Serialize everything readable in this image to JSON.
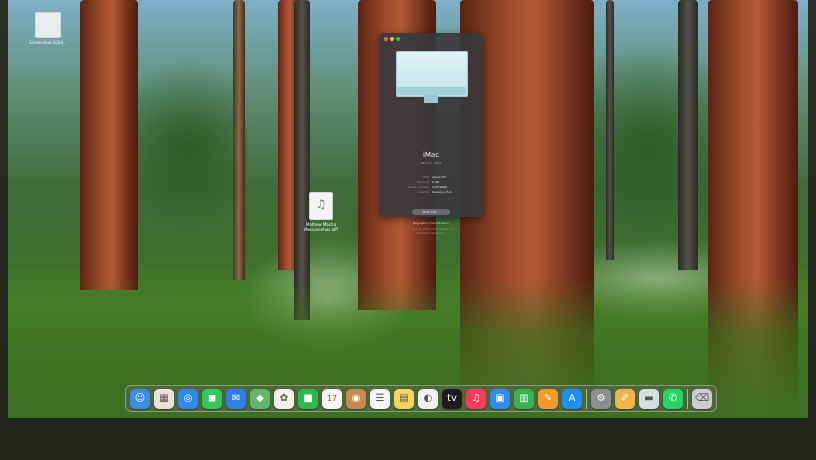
{
  "desktop": {
    "icons": [
      {
        "label": "Screenshot 2024…"
      },
      {
        "label": "Mathew Macha Mascarenhas.aiff"
      }
    ]
  },
  "about_window": {
    "traffic_colors": [
      "#ff5f57",
      "#febc2e",
      "#28c840"
    ],
    "title": "iMac",
    "model": "24-inch, 2021",
    "specs": [
      {
        "key": "Chip",
        "value": "Apple M1"
      },
      {
        "key": "Memory",
        "value": "8 GB"
      },
      {
        "key": "Serial number",
        "value": "C02TJ0KJ0"
      },
      {
        "key": "macOS",
        "value": "Sequoia 15.0"
      }
    ],
    "more_info_label": "More Info…",
    "regulatory_label": "Regulatory Certification",
    "legal_lines": [
      "™ and © 1983-2024 Apple Inc.",
      "All Rights Reserved."
    ]
  },
  "dock": {
    "apps": [
      {
        "name": "finder-icon",
        "color": "#3b8ee8",
        "glyph": "☺"
      },
      {
        "name": "launchpad-icon",
        "color": "#e9e3d9",
        "glyph": "▦"
      },
      {
        "name": "safari-icon",
        "color": "#2d8ceb",
        "glyph": "◎"
      },
      {
        "name": "messages-icon",
        "color": "#34c759",
        "glyph": "◼"
      },
      {
        "name": "mail-icon",
        "color": "#2f7fe6",
        "glyph": "✉"
      },
      {
        "name": "maps-icon",
        "color": "#5fb86a",
        "glyph": "◆"
      },
      {
        "name": "photos-icon",
        "color": "#f4f0ea",
        "glyph": "✿"
      },
      {
        "name": "facetime-icon",
        "color": "#2fb84a",
        "glyph": "■"
      },
      {
        "name": "calendar-icon",
        "color": "#f7f7f7",
        "glyph": "17"
      },
      {
        "name": "contacts-icon",
        "color": "#c98a4e",
        "glyph": "◉"
      },
      {
        "name": "reminders-icon",
        "color": "#f5f5f5",
        "glyph": "☰"
      },
      {
        "name": "notes-icon",
        "color": "#f6d35c",
        "glyph": "▤"
      },
      {
        "name": "freeform-icon",
        "color": "#f2f2f2",
        "glyph": "◐"
      },
      {
        "name": "tv-icon",
        "color": "#1c1c1e",
        "glyph": "tv"
      },
      {
        "name": "music-icon",
        "color": "#fa3c5a",
        "glyph": "♫"
      },
      {
        "name": "keynote-icon",
        "color": "#2f8df0",
        "glyph": "▣"
      },
      {
        "name": "numbers-icon",
        "color": "#34b34f",
        "glyph": "▥"
      },
      {
        "name": "pages-icon",
        "color": "#f39a2b",
        "glyph": "✎"
      },
      {
        "name": "app-store-icon",
        "color": "#1d8ff0",
        "glyph": "A"
      },
      {
        "name": "system-settings-icon",
        "color": "#8e8e93",
        "glyph": "⚙"
      },
      {
        "name": "utility-icon",
        "color": "#f0b24a",
        "glyph": "✐"
      },
      {
        "name": "disk-utility-icon",
        "color": "#d9dde2",
        "glyph": "▬"
      },
      {
        "name": "whatsapp-icon",
        "color": "#25d366",
        "glyph": "✆"
      },
      {
        "name": "trash-icon",
        "color": "#c9ced3",
        "glyph": "⌫"
      }
    ]
  }
}
